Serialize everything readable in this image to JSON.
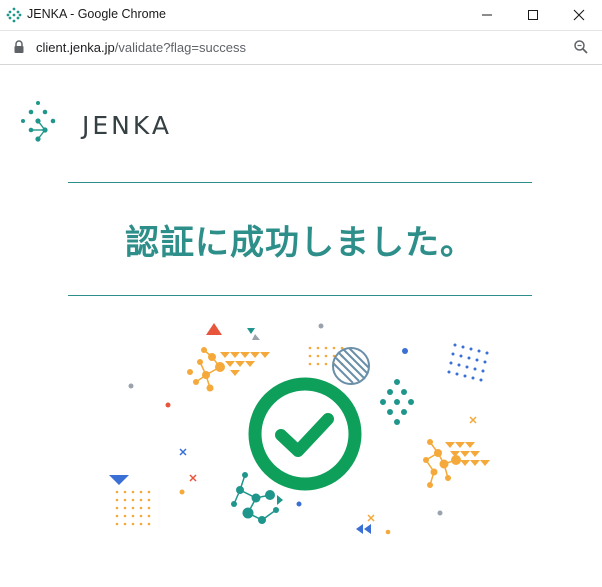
{
  "window": {
    "title": "JENKA - Google Chrome",
    "controls": [
      "minimize-icon",
      "maximize-icon",
      "close-icon"
    ]
  },
  "address_bar": {
    "url_host": "client.jenka.jp",
    "url_path": "/validate?flag=success",
    "icons": [
      "lock-icon",
      "zoom-icon"
    ]
  },
  "brand": {
    "logo_text": "JENKA",
    "logo_color": "#1f968c",
    "text_color": "#354043"
  },
  "page": {
    "message": "認証に成功しました。",
    "accent_color": "#2e8f8a",
    "success_color": "#0e9f5a",
    "decor_colors": [
      "#f4a93a",
      "#1f968c",
      "#e8553d",
      "#3a6fd6",
      "#9aa3ad"
    ],
    "status_icon": "checkmark-circle-icon"
  }
}
